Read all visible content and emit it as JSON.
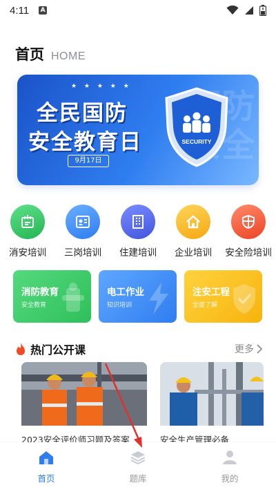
{
  "status_bar": {
    "time": "4:11",
    "notification_letter": "A"
  },
  "header": {
    "title": "首页",
    "subtitle": "HOME"
  },
  "banner": {
    "line1": "全民国防",
    "line2": "安全教育日",
    "date": "9月17日",
    "shield_text": "SECURITY",
    "background_text": "国防安全",
    "stars": "★ ★ ★ ★ ★"
  },
  "categories": [
    {
      "label": "消安培训",
      "icon": "cert-icon",
      "color": "#33c463"
    },
    {
      "label": "三岗培训",
      "icon": "id-card-icon",
      "color": "#3d8af7"
    },
    {
      "label": "住建培训",
      "icon": "building-icon",
      "color": "#5064e8"
    },
    {
      "label": "企业培训",
      "icon": "home-icon",
      "color": "#f7b81f"
    },
    {
      "label": "安全险培训",
      "icon": "shield-icon",
      "color": "#f25a3c"
    }
  ],
  "features": [
    {
      "title": "消防教育",
      "subtitle": "安全教育",
      "color": "#3fcf6b",
      "icon": "hydrant-icon"
    },
    {
      "title": "电工作业",
      "subtitle": "知识培训",
      "color": "#3f8ef7",
      "icon": "lightning-icon"
    },
    {
      "title": "注安工程",
      "subtitle": "全面了解",
      "color": "#f8c01d",
      "icon": "shield-check-icon"
    }
  ],
  "section": {
    "title": "热门公开课",
    "more": "更多"
  },
  "courses": [
    {
      "caption": "2023安全评价师习题及答案"
    },
    {
      "caption": "安全生产管理必备"
    }
  ],
  "bottom_nav": [
    {
      "label": "首页",
      "icon": "home-icon",
      "active": true
    },
    {
      "label": "题库",
      "icon": "layers-icon",
      "active": false
    },
    {
      "label": "我的",
      "icon": "user-icon",
      "active": false
    }
  ],
  "colors": {
    "accent": "#2f7ef0",
    "annotation_arrow": "#e0312c"
  }
}
